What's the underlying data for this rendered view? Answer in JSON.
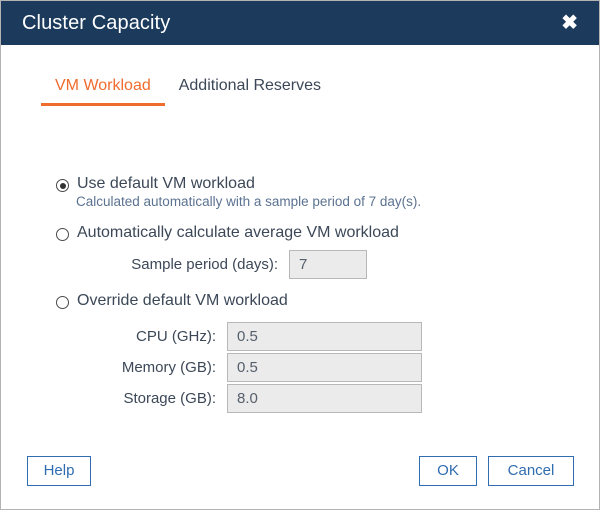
{
  "dialog": {
    "title": "Cluster Capacity",
    "close_icon": "close-icon"
  },
  "tabs": [
    {
      "label": "VM Workload",
      "active": true
    },
    {
      "label": "Additional Reserves",
      "active": false
    }
  ],
  "options": [
    {
      "label": "Use default VM workload",
      "selected": true,
      "helper": "Calculated automatically with a sample period of 7 day(s)."
    },
    {
      "label": "Automatically calculate average VM workload",
      "selected": false
    },
    {
      "label": "Override default VM workload",
      "selected": false
    }
  ],
  "fields": {
    "sample_period": {
      "label": "Sample period (days):",
      "value": "7"
    },
    "cpu": {
      "label": "CPU (GHz):",
      "value": "0.5"
    },
    "memory": {
      "label": "Memory (GB):",
      "value": "0.5"
    },
    "storage": {
      "label": "Storage (GB):",
      "value": "8.0"
    }
  },
  "buttons": {
    "help": "Help",
    "ok": "OK",
    "cancel": "Cancel"
  },
  "colors": {
    "titlebar": "#1b3a5c",
    "accent": "#ef6c2e",
    "button_blue": "#2f6cb0",
    "helper_text": "#5b7290"
  }
}
